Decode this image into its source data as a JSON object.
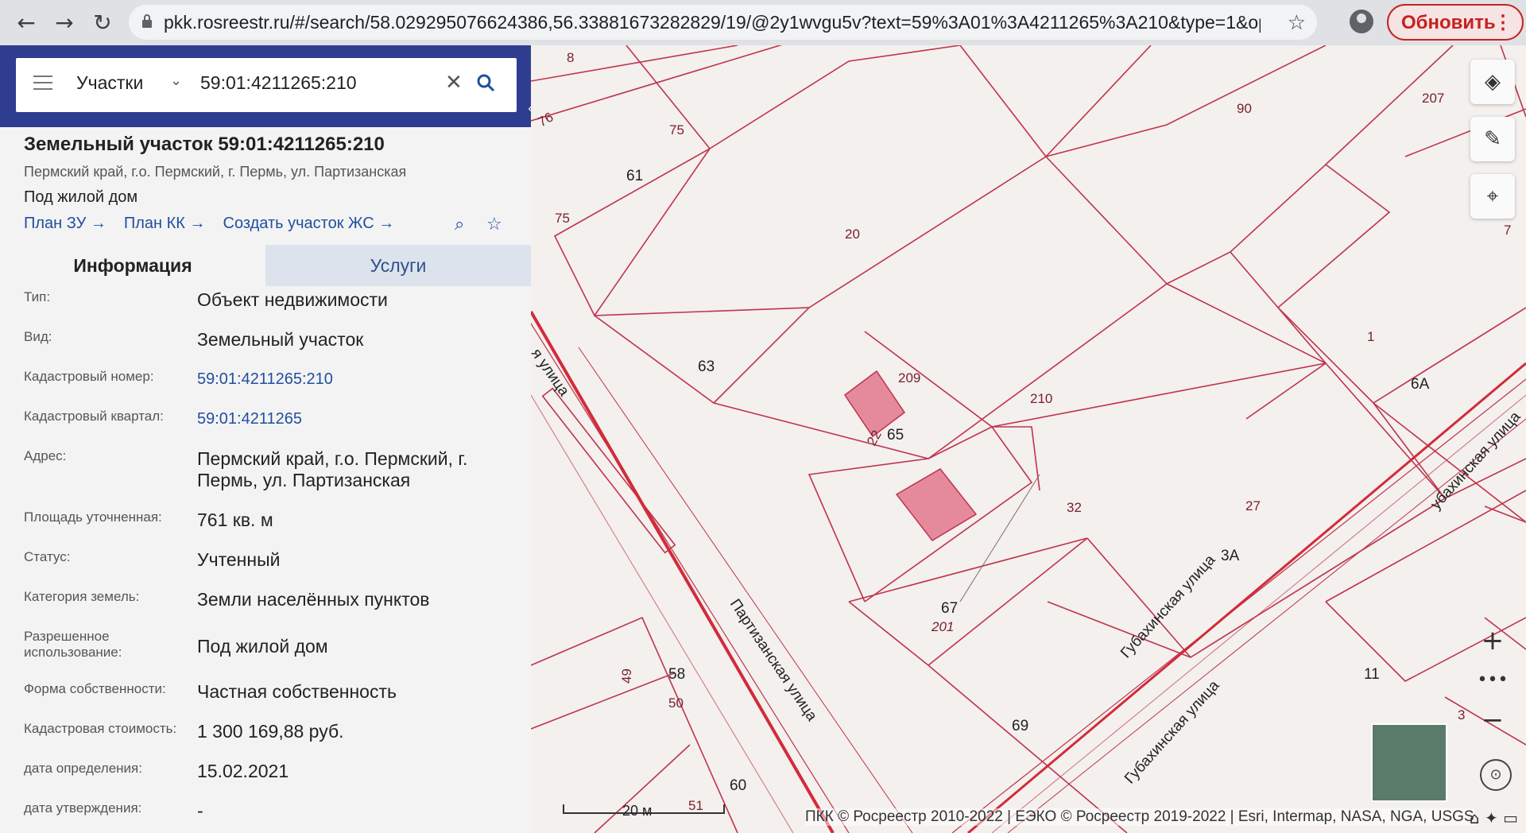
{
  "browser": {
    "url": "pkk.rosreestr.ru/#/search/58.029295076624386,56.33881673282829/19/@2y1wvgu5v?text=59%3A01%3A4211265%3A210&type=1&opened=59%3...",
    "update_label": "Обновить"
  },
  "search": {
    "layer": "Участки",
    "query": "59:01:4211265:210"
  },
  "object": {
    "title": "Земельный участок 59:01:4211265:210",
    "address_line": "Пермский край, г.о. Пермский, г. Пермь, ул. Партизанская",
    "use_line": "Под жилой дом",
    "links": [
      "План ЗУ →",
      "План КК →",
      "Создать участок ЖС →"
    ]
  },
  "tabs": {
    "info": "Информация",
    "services": "Услуги"
  },
  "attributes": [
    {
      "key": "Тип:",
      "value": "Объект недвижимости"
    },
    {
      "key": "Вид:",
      "value": "Земельный участок"
    },
    {
      "key": "Кадастровый номер:",
      "value": "59:01:4211265:210"
    },
    {
      "key": "Кадастровый квартал:",
      "value": "59:01:4211265"
    },
    {
      "key": "Адрес:",
      "value": "Пермский край, г.о. Пермский, г. Пермь, ул. Партизанская"
    },
    {
      "key": "Площадь уточненная:",
      "value": "761 кв. м"
    },
    {
      "key": "Статус:",
      "value": "Учтенный"
    },
    {
      "key": "Категория земель:",
      "value": "Земли населённых пунктов"
    },
    {
      "key": "Разрешенное использование:",
      "value": "Под жилой дом"
    },
    {
      "key": "Форма собственности:",
      "value": "Частная собственность"
    },
    {
      "key": "Кадастровая стоимость:",
      "value": "1 300 169,88 руб."
    },
    {
      "key": "дата определения:",
      "value": "15.02.2021"
    },
    {
      "key": "дата утверждения:",
      "value": "-"
    }
  ],
  "map": {
    "plot_labels": [
      "8",
      "76",
      "75",
      "61",
      "75",
      "20",
      "90",
      "207",
      "63",
      "209",
      "210",
      "1",
      "6А",
      "65",
      "22",
      "32",
      "27",
      "3А",
      "67",
      "201",
      "49",
      "58",
      "50",
      "69",
      "11",
      "60",
      "51",
      "3",
      "7"
    ],
    "streets": [
      "я улица",
      "Партизанская улица",
      "Губахинская улица",
      "убахинская улица",
      "Губахинская улица"
    ],
    "scale": "20 м",
    "attribution": "ПКК © Росреестр 2010-2022 | ЕЭКО © Росреестр 2019-2022 | Esri, Intermap, NASA, NGA, USGS"
  },
  "colors": {
    "header_blue": "#2e3d8f",
    "link_blue": "#1f4fa0",
    "parcel_line": "#c0334b",
    "building_fill": "#e58a9c",
    "update_red": "#c5221f"
  }
}
